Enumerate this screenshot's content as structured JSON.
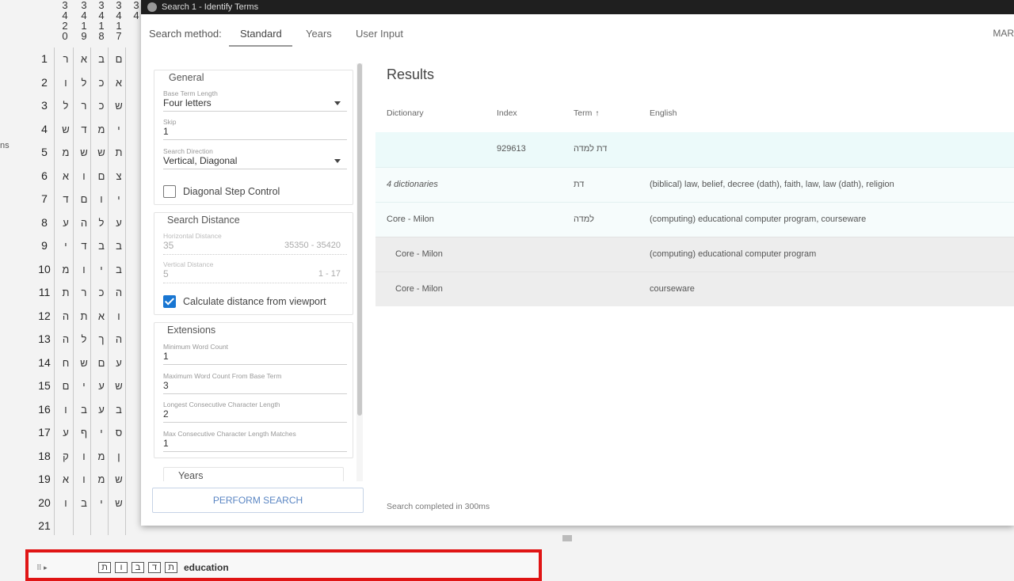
{
  "left_cut_text": "ns",
  "grid": {
    "header_columns": [
      [
        "3",
        "4",
        "2",
        "0"
      ],
      [
        "3",
        "4",
        "1",
        "9"
      ],
      [
        "3",
        "4",
        "1",
        "8"
      ],
      [
        "3",
        "4",
        "1",
        "7"
      ],
      [
        "3",
        "4"
      ]
    ],
    "row_numbers": [
      "1",
      "2",
      "3",
      "4",
      "5",
      "6",
      "7",
      "8",
      "9",
      "10",
      "11",
      "12",
      "13",
      "14",
      "15",
      "16",
      "17",
      "18",
      "19",
      "20",
      "21"
    ],
    "rows": [
      [
        "ר",
        "א",
        "ב",
        "ם"
      ],
      [
        "ו",
        "ל",
        "כ",
        "א"
      ],
      [
        "ל",
        "ר",
        "כ",
        "ש"
      ],
      [
        "ש",
        "ד",
        "מ",
        "י"
      ],
      [
        "מ",
        "ש",
        "ש",
        "ת"
      ],
      [
        "א",
        "ו",
        "ם",
        "צ"
      ],
      [
        "ד",
        "ם",
        "ו",
        "י"
      ],
      [
        "ע",
        "ה",
        "ל",
        "ע"
      ],
      [
        "י",
        "ד",
        "ב",
        "ב"
      ],
      [
        "מ",
        "ו",
        "י",
        "ב"
      ],
      [
        "ת",
        "ר",
        "כ",
        "ה"
      ],
      [
        "ה",
        "ת",
        "א",
        "ו"
      ],
      [
        "ה",
        "ל",
        "ך",
        "ה"
      ],
      [
        "ח",
        "ש",
        "ם",
        "ע"
      ],
      [
        "ם",
        "י",
        "ע",
        "ש"
      ],
      [
        "ו",
        "ב",
        "ע",
        "ב"
      ],
      [
        "ע",
        "ף",
        "י",
        "ס"
      ],
      [
        "ק",
        "ו",
        "מ",
        "ן"
      ],
      [
        "א",
        "ו",
        "מ",
        "ש"
      ],
      [
        "ו",
        "ב",
        "י",
        "ש"
      ],
      [
        "",
        "",
        "",
        ""
      ]
    ]
  },
  "dialog": {
    "title": "Search 1 - Identify Terms",
    "nav": {
      "label": "Search method:",
      "tabs": [
        "Standard",
        "Years",
        "User Input"
      ],
      "active_tab": "Standard",
      "right_text": "MAR"
    },
    "general": {
      "title": "General",
      "base_term_length": {
        "label": "Base Term Length",
        "value": "Four letters"
      },
      "skip": {
        "label": "Skip",
        "value": "1"
      },
      "search_direction": {
        "label": "Search Direction",
        "value": "Vertical, Diagonal"
      },
      "diagonal_step": {
        "label": "Diagonal Step Control",
        "checked": false
      }
    },
    "search_distance": {
      "title": "Search Distance",
      "horizontal": {
        "label": "Horizontal Distance",
        "value": "35",
        "range": "35350 - 35420"
      },
      "vertical": {
        "label": "Vertical Distance",
        "value": "5",
        "range": "1 - 17"
      },
      "calc_viewport": {
        "label": "Calculate distance from viewport",
        "checked": true
      }
    },
    "extensions": {
      "title": "Extensions",
      "min_word_count": {
        "label": "Minimum Word Count",
        "value": "1"
      },
      "max_word_count": {
        "label": "Maximum Word Count From Base Term",
        "value": "3"
      },
      "longest_consec": {
        "label": "Longest Consecutive Character Length",
        "value": "2"
      },
      "max_consec_matches": {
        "label": "Max Consecutive Character Length Matches",
        "value": "1"
      }
    },
    "years": {
      "title": "Years"
    },
    "perform_search": "PERFORM SEARCH",
    "results": {
      "title": "Results",
      "columns": {
        "dictionary": "Dictionary",
        "index": "Index",
        "term": "Term",
        "english": "English"
      },
      "sort_indicator": "↑",
      "rows": [
        {
          "dictionary": "",
          "index": "929613",
          "term": "דת למדה",
          "english": ""
        },
        {
          "dictionary": "4 dictionaries",
          "index": "",
          "term": "דת",
          "english": "(biblical) law, belief, decree (dath), faith, law, law (dath), religion"
        },
        {
          "dictionary": "Core - Milon",
          "index": "",
          "term": "למדה",
          "english": "(computing) educational computer program, courseware"
        },
        {
          "dictionary": "Core - Milon",
          "index": "",
          "term": "",
          "english": "(computing) educational computer program"
        },
        {
          "dictionary": "Core - Milon",
          "index": "",
          "term": "",
          "english": "courseware"
        }
      ],
      "status": "Search completed in 300ms"
    }
  },
  "bottom_bar": {
    "handle": "⠿ ▸",
    "letters": [
      "ת",
      "ו",
      "ב",
      "ד",
      "ת"
    ],
    "word": "education"
  },
  "colors": {
    "accent": "#1976d2",
    "highlight_border": "#e01515",
    "result_highlight": "#ecfafa"
  }
}
